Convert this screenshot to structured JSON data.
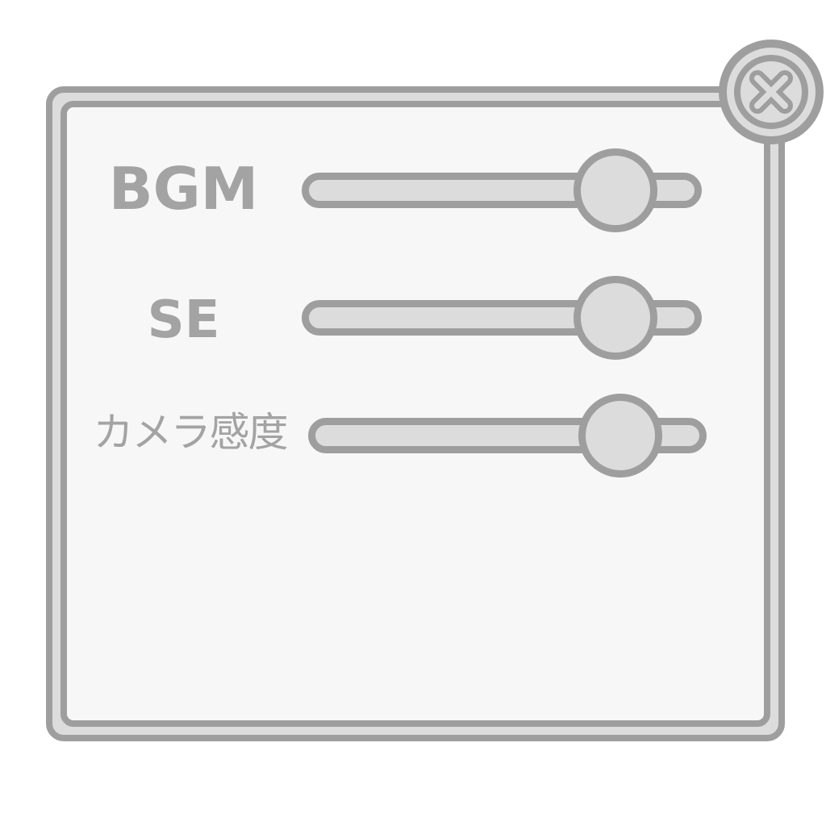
{
  "settings": {
    "bgm": {
      "label": "BGM",
      "value": 0.86
    },
    "se": {
      "label": "SE",
      "value": 0.86
    },
    "camera_sensitivity": {
      "label": "カメラ感度",
      "value": 0.86
    }
  },
  "close_button": {
    "icon": "close-icon"
  },
  "colors": {
    "border": "#9e9e9e",
    "fill": "#dcdcdc",
    "panel_background": "#f7f7f7",
    "text": "#a3a3a3"
  }
}
